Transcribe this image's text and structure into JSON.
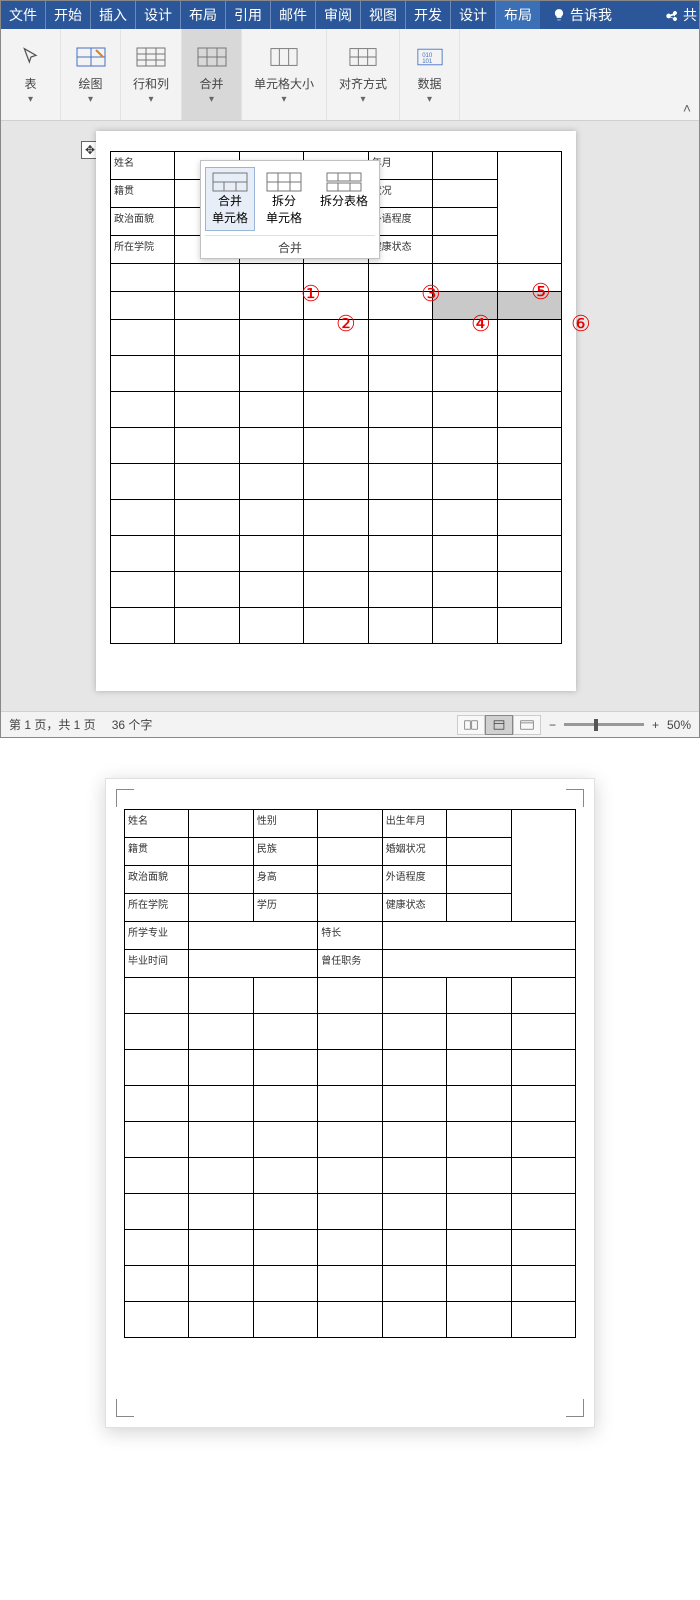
{
  "tabs": [
    "文件",
    "开始",
    "插入",
    "设计",
    "布局",
    "引用",
    "邮件",
    "审阅",
    "视图",
    "开发",
    "设计",
    "布局"
  ],
  "active_tab_index": 11,
  "design_tab_index": 10,
  "tell_me": "告诉我",
  "ribbon": {
    "table": "表",
    "draw": "绘图",
    "rowscols": "行和列",
    "merge": "合并",
    "cellsize": "单元格大小",
    "align": "对齐方式",
    "data": "数据"
  },
  "dropdown": {
    "merge_cells": "合并\n单元格",
    "split_cells": "拆分\n单元格",
    "split_table": "拆分表格",
    "group_label": "合并"
  },
  "page1": {
    "labels": {
      "name": "姓名",
      "born_month": "年月",
      "origin": "籍贯",
      "status_col": "状况",
      "politics": "政治面貌",
      "height": "身高",
      "foreign": "外语程度",
      "college": "所在学院",
      "education": "学历",
      "health": "健康状态"
    }
  },
  "circles": {
    "c1": "①",
    "c2": "②",
    "c3": "③",
    "c4": "④",
    "c5": "⑤",
    "c6": "⑥"
  },
  "status": {
    "page": "第 1 页，共 1 页",
    "words": "36 个字",
    "zoom": "50%"
  },
  "page2": {
    "r1": {
      "a": "姓名",
      "b": "性别",
      "c": "出生年月"
    },
    "r2": {
      "a": "籍贯",
      "b": "民族",
      "c": "婚姻状况"
    },
    "r3": {
      "a": "政治面貌",
      "b": "身高",
      "c": "外语程度"
    },
    "r4": {
      "a": "所在学院",
      "b": "学历",
      "c": "健康状态"
    },
    "r5": {
      "a": "所学专业",
      "b": "特长"
    },
    "r6": {
      "a": "毕业时间",
      "b": "曾任职务"
    }
  }
}
